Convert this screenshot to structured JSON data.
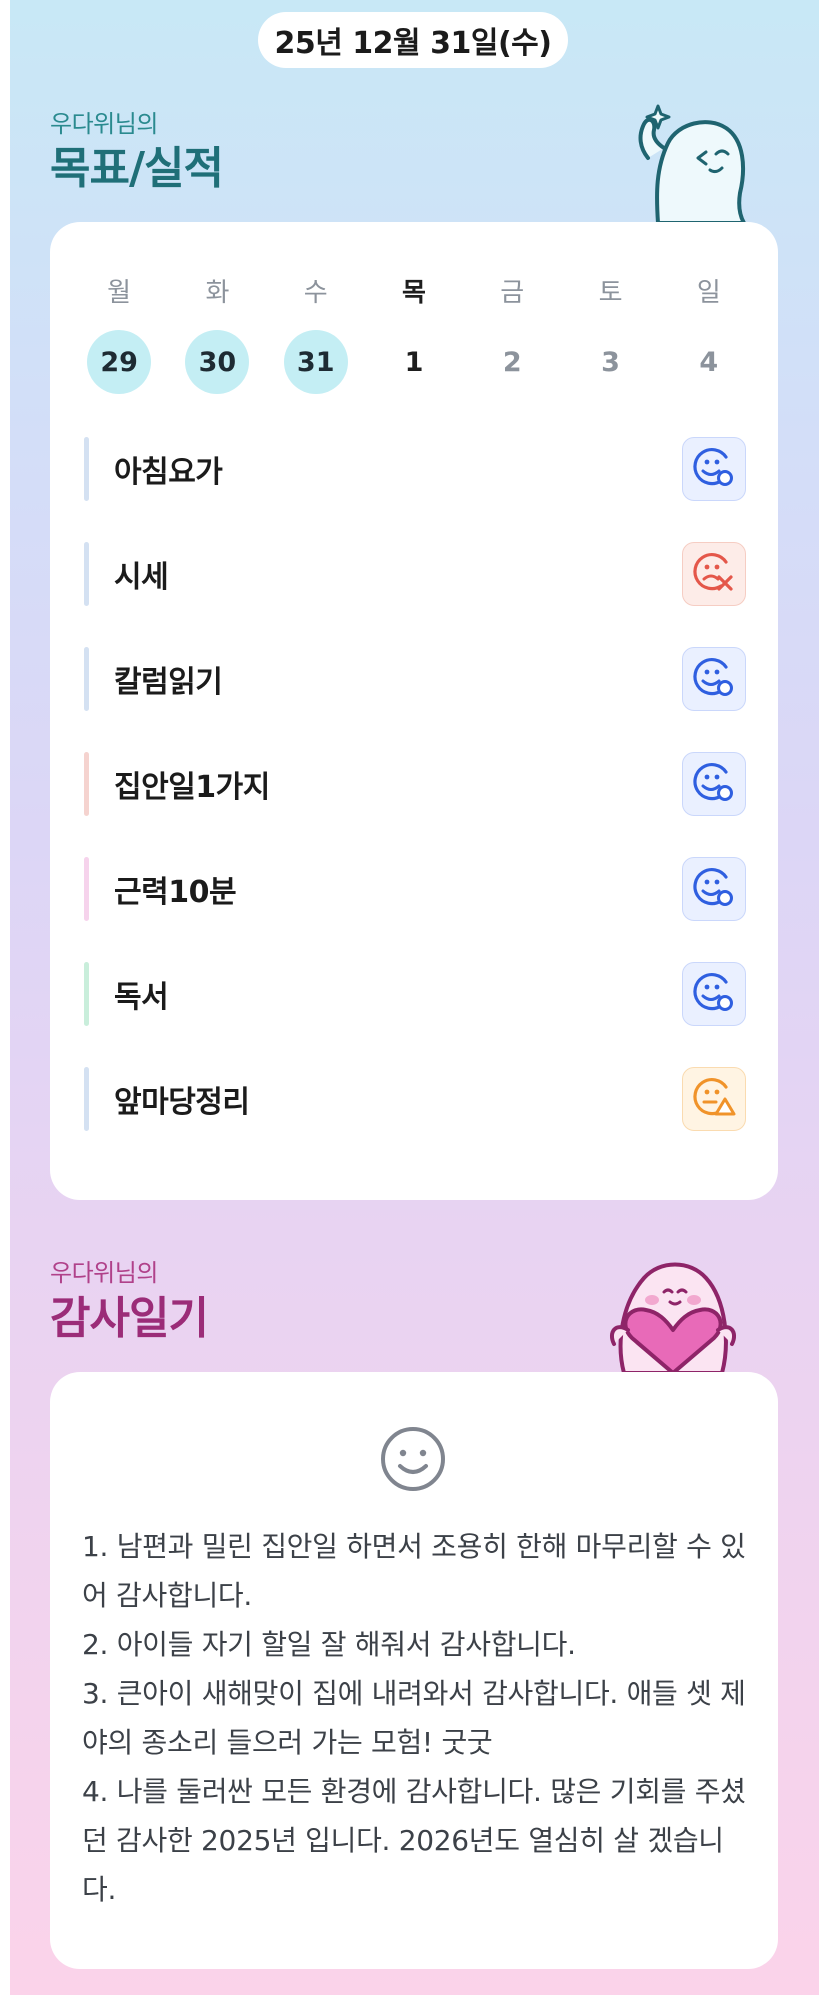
{
  "header": {
    "date": "25년 12월 31일(수)"
  },
  "goals_section": {
    "subtitle": "우다위님의",
    "title": "목표/실적"
  },
  "week": {
    "days": [
      {
        "weekday": "월",
        "date": "29",
        "state": "done"
      },
      {
        "weekday": "화",
        "date": "30",
        "state": "done"
      },
      {
        "weekday": "수",
        "date": "31",
        "state": "done"
      },
      {
        "weekday": "목",
        "date": "1",
        "state": "today"
      },
      {
        "weekday": "금",
        "date": "2",
        "state": "future"
      },
      {
        "weekday": "토",
        "date": "3",
        "state": "future"
      },
      {
        "weekday": "일",
        "date": "4",
        "state": "future"
      }
    ]
  },
  "goals": [
    {
      "label": "아침요가",
      "status": "success",
      "accent": "#d4e1f2"
    },
    {
      "label": "시세",
      "status": "fail",
      "accent": "#d4e1f2"
    },
    {
      "label": "칼럼읽기",
      "status": "success",
      "accent": "#d4e1f2"
    },
    {
      "label": "집안일1가지",
      "status": "success",
      "accent": "#f5d3cf"
    },
    {
      "label": "근력10분",
      "status": "success",
      "accent": "#f6d3ec"
    },
    {
      "label": "독서",
      "status": "success",
      "accent": "#c9eedb"
    },
    {
      "label": "앞마당정리",
      "status": "partial",
      "accent": "#d4e1f2"
    }
  ],
  "status_colors": {
    "success": "#2f5fe0",
    "fail": "#e4574a",
    "partial": "#f0932a"
  },
  "gratitude_section": {
    "subtitle": "우다위님의",
    "title": "감사일기",
    "lines": [
      "1. 남편과 밀린 집안일 하면서 조용히 한해 마무리할 수 있어 감사합니다.",
      "2. 아이들 자기 할일 잘 해줘서 감사합니다.",
      "3. 큰아이 새해맞이 집에 내려와서 감사합니다. 애들 셋 제야의 종소리 들으러 가는 모험! 굿굿",
      "4. 나를 둘러싼 모든 환경에 감사합니다. 많은 기회를 주셨던 감사한 2025년 입니다. 2026년도 열심히 살 겠습니다."
    ]
  },
  "icons": {
    "mascot_top": "ghost-mascot-pointing",
    "mascot_bottom": "ghost-mascot-heart",
    "gratitude_mood": "smile-face-icon"
  }
}
